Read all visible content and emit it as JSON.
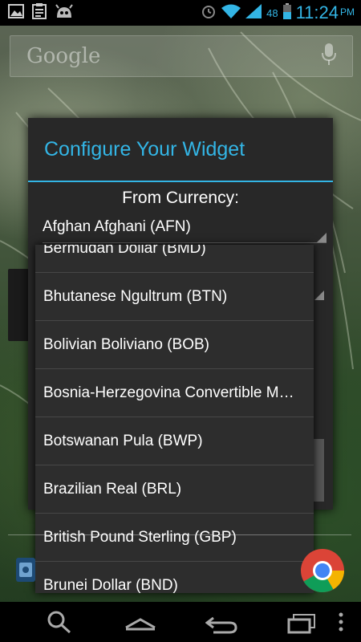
{
  "status_bar": {
    "notification_icons": [
      "gallery-icon",
      "clipboard-icon",
      "cyanogen-icon"
    ],
    "battery_percent": "48",
    "time": "11:24",
    "ampm": "PM",
    "accent_color": "#33b5e5"
  },
  "search": {
    "placeholder": "Google"
  },
  "dialog": {
    "title": "Configure Your Widget",
    "from_label": "From Currency:",
    "selected_currency": "Afghan Afghani (AFN)"
  },
  "dropdown": {
    "items": [
      "Bermudan Dollar (BMD)",
      "Bhutanese Ngultrum (BTN)",
      "Bolivian Boliviano (BOB)",
      "Bosnia-Herzegovina Convertible M…",
      "Botswanan Pula (BWP)",
      "Brazilian Real (BRL)",
      "British Pound Sterling (GBP)",
      "Brunei Dollar (BND)"
    ]
  },
  "nav_bar": {
    "buttons": [
      "search-icon",
      "home-icon",
      "back-icon",
      "recent-apps-icon",
      "menu-icon"
    ]
  }
}
